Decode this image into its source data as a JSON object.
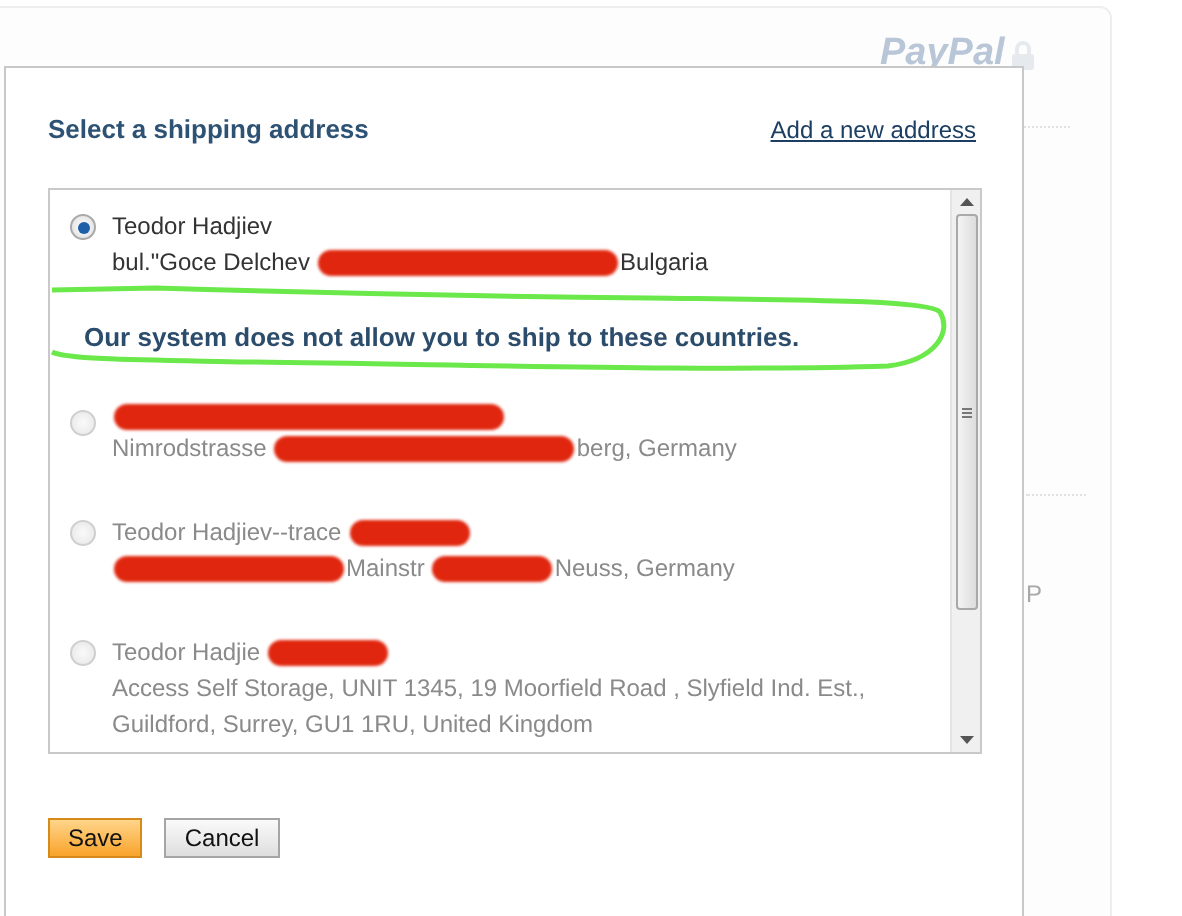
{
  "background": {
    "logo": "PayPal",
    "side_text": "P"
  },
  "dialog": {
    "title": "Select a shipping address",
    "add_link": "Add a new address",
    "addresses": [
      {
        "selected": true,
        "disabled": false,
        "lines": [
          [
            {
              "kind": "text",
              "text": "Teodor Hadjiev"
            }
          ],
          [
            {
              "kind": "text",
              "text": "bul.\"Goce Delchev"
            },
            {
              "kind": "redaction"
            },
            {
              "kind": "text",
              "text": "Bulgaria"
            }
          ]
        ],
        "warning": "Our system does not allow you to ship to these countries.",
        "highlighted": true
      },
      {
        "selected": false,
        "disabled": true,
        "lines": [
          [
            {
              "kind": "redaction"
            }
          ],
          [
            {
              "kind": "text",
              "text": "Nimrodstrasse"
            },
            {
              "kind": "redaction"
            },
            {
              "kind": "text",
              "text": "berg, Germany"
            }
          ]
        ]
      },
      {
        "selected": false,
        "disabled": true,
        "lines": [
          [
            {
              "kind": "text",
              "text": "Teodor Hadjiev--trace"
            },
            {
              "kind": "redaction"
            }
          ],
          [
            {
              "kind": "redaction"
            },
            {
              "kind": "text",
              "text": "Mainstr"
            },
            {
              "kind": "redaction"
            },
            {
              "kind": "text",
              "text": "Neuss, Germany"
            }
          ]
        ]
      },
      {
        "selected": false,
        "disabled": true,
        "lines": [
          [
            {
              "kind": "text",
              "text": "Teodor Hadjie"
            },
            {
              "kind": "redaction"
            }
          ],
          [
            {
              "kind": "text",
              "text": "Access Self Storage, UNIT 1345, 19 Moorfield Road , Slyfield Ind. Est.,"
            }
          ],
          [
            {
              "kind": "text",
              "text": "Guildford, Surrey, GU1 1RU, United Kingdom"
            }
          ]
        ]
      }
    ],
    "buttons": [
      {
        "label": "Save",
        "kind": "primary"
      },
      {
        "label": "Cancel",
        "kind": "secondary"
      }
    ]
  }
}
